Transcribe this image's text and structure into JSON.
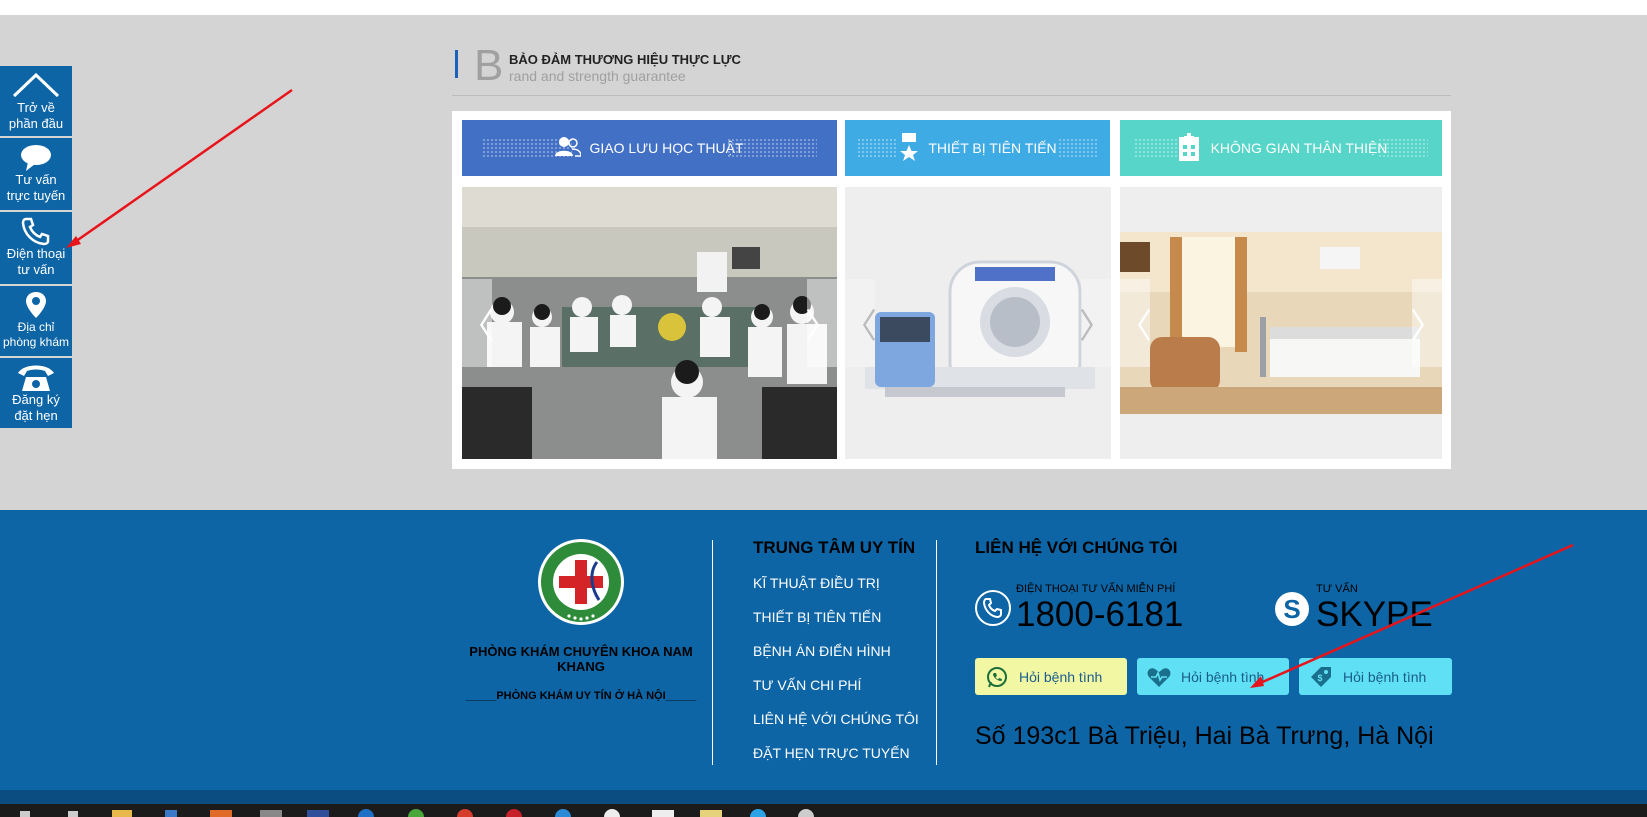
{
  "sidebar": {
    "items": [
      {
        "label1": "Trở về",
        "label2": "phần đầu",
        "icon": "home-roof-icon"
      },
      {
        "label1": "Tư vấn",
        "label2": "trực tuyến",
        "icon": "chat-bubble-icon"
      },
      {
        "label1": "Điện thoại",
        "label2": "tư vấn",
        "icon": "phone-icon"
      },
      {
        "label1": "Địa chỉ",
        "label2": "phòng khám",
        "icon": "map-pin-icon"
      },
      {
        "label1": "Đăng ký",
        "label2": "đặt hẹn",
        "icon": "telephone-handset-icon"
      }
    ]
  },
  "section": {
    "big_letter": "B",
    "title": "BẢO ĐẢM THƯƠNG HIỆU THỰC LỰC",
    "subtitle": "rand and strength guarantee"
  },
  "tabs": [
    {
      "label": "GIAO LƯU HỌC THUẬT",
      "icon": "people-icon",
      "color": "#4270c4"
    },
    {
      "label": "THIẾT BỊ TIÊN TIẾN",
      "icon": "medal-icon",
      "color": "#3fabe4"
    },
    {
      "label": "KHÔNG GIAN THÂN THIỆN",
      "icon": "hospital-icon",
      "color": "#56d5c8"
    }
  ],
  "carousel": {
    "prev": "〈",
    "next": "〉"
  },
  "footer": {
    "clinic_name": "PHÒNG KHÁM CHUYÊN KHOA NAM KHANG",
    "clinic_sub": "_____PHÒNG KHÁM UY TÍN Ở HÀ NỘI_____",
    "col2_title": "TRUNG TÂM UY TÍN",
    "col2_links": [
      "KĨ THUẬT ĐIỀU TRỊ",
      "THIẾT BỊ TIÊN TIẾN",
      "BỆNH ÁN ĐIỂN HÌNH",
      "TƯ VẤN CHI PHÍ",
      "LIÊN HỆ VỚI CHÚNG TÔI",
      "ĐẶT HẸN TRỰC TUYẾN"
    ],
    "col3_title": "LIÊN HỆ VỚI CHÚNG TÔI",
    "phone_label": "ĐIỆN THOẠI TƯ VẤN MIỄN PHÍ",
    "phone_number": "1800-6181",
    "skype_label": "TƯ VẤN",
    "skype_text": "SKYPE",
    "ask_buttons": [
      "Hỏi bệnh tình",
      "Hỏi bệnh tình",
      "Hỏi bệnh tình"
    ],
    "address": "Số 193c1 Bà Triệu, Hai Bà Trưng, Hà Nội"
  },
  "colors": {
    "footer_bg": "#0d65a6",
    "sidebar_bg": "#0d65a6",
    "arrow": "#e8141b"
  }
}
